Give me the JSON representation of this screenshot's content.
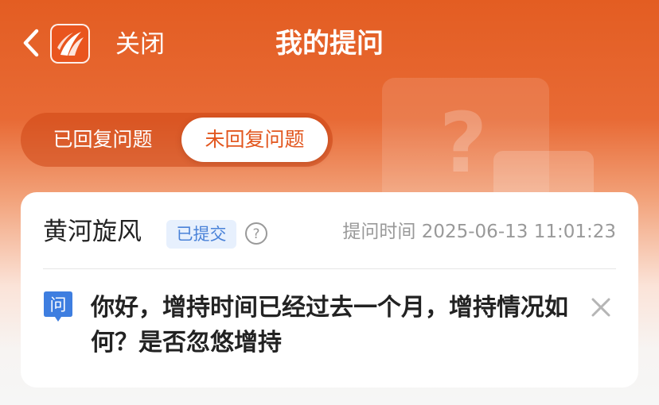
{
  "header": {
    "close_label": "关闭",
    "title": "我的提问",
    "back_icon": "chevron-left-icon",
    "logo": "app-logo"
  },
  "tabs": [
    {
      "label": "已回复问题",
      "selected": false
    },
    {
      "label": "未回复问题",
      "selected": true
    }
  ],
  "question_card": {
    "user_name": "黄河旋风",
    "status_badge": "已提交",
    "time_label": "提问时间 2025-06-13 11:01:23",
    "question_tag": "问",
    "question_text": "你好，增持时间已经过去一个月，增持情况如何？是否忽悠增持",
    "help_icon": "question-circle-icon",
    "dismiss_icon": "close-icon"
  },
  "colors": {
    "brand": "#e35d22",
    "badge_text": "#4a82d8",
    "badge_bg": "#e7f0fd",
    "tag_bg": "#3e7ee0"
  }
}
